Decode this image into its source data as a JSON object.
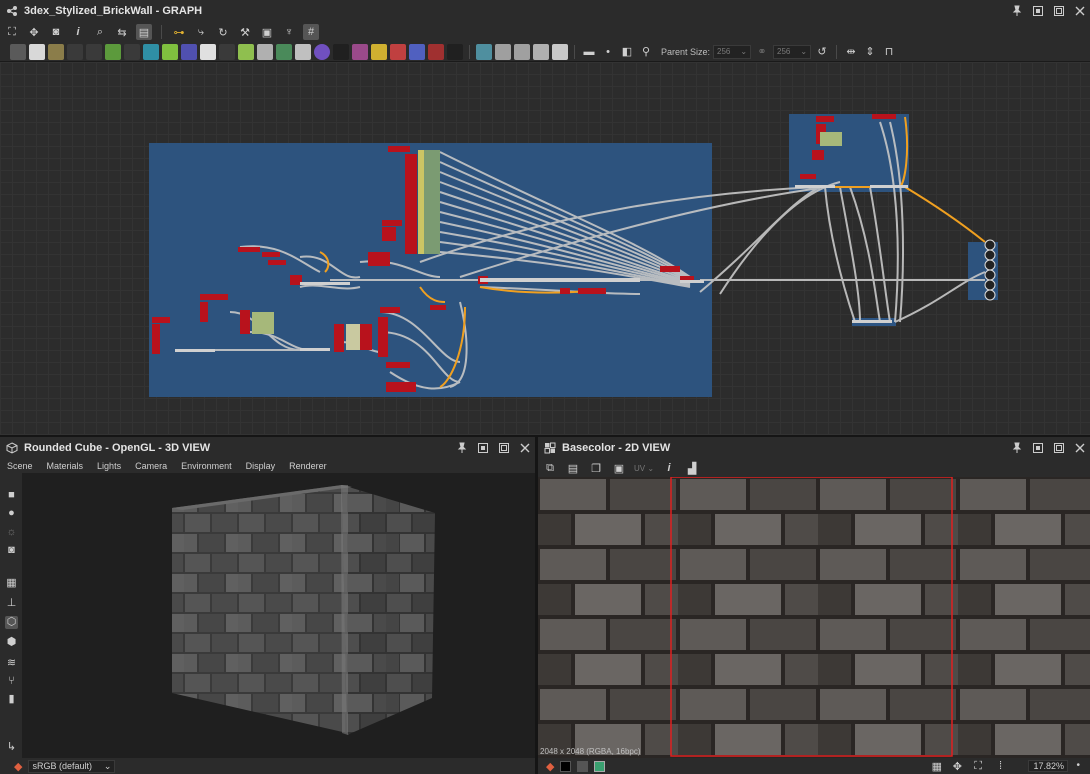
{
  "graph": {
    "title": "3dex_Stylized_BrickWall - GRAPH",
    "parent_size_label": "Parent Size:",
    "parent_size_w": "256",
    "parent_size_h": "256",
    "node_toolbar_colors": [
      "#6a6a6a",
      "#d8d8d8",
      "#8b7d4a",
      "#2f7fa5",
      "#e07a2f",
      "#5c9a3c",
      "#7a7a7a",
      "#2f8fa5",
      "#7fbf3f",
      "#5050b0",
      "#e0e0e0",
      "#3a3a3a",
      "#8fbf4f",
      "#b0b0b0",
      "#4a8a5a",
      "#c0c0c0",
      "#7050c0",
      "#202020",
      "#9a4a8a",
      "#d0b030",
      "#c04040",
      "#5060c0",
      "#a03030",
      "#202020",
      "#4f8f9f",
      "#9f9f9f",
      "#a0a0a0",
      "#b0b0b0",
      "#c8c8c8"
    ]
  },
  "view3d": {
    "title": "Rounded Cube - OpenGL - 3D VIEW",
    "menu": [
      "Scene",
      "Materials",
      "Lights",
      "Camera",
      "Environment",
      "Display",
      "Renderer"
    ],
    "colorspace": "sRGB (default)"
  },
  "view2d": {
    "title": "Basecolor - 2D VIEW",
    "uv_label": "UV",
    "info": "2048 x 2048 (RGBA, 16bpc)",
    "zoom": "17.82%"
  },
  "colors": {
    "panel": "#2b2b2b",
    "graph_frame": "#2d5583",
    "node_red": "#b8121c",
    "wire": "#bdbdbd",
    "wire_orange": "#f0a020",
    "tile_guide": "#e02020"
  }
}
